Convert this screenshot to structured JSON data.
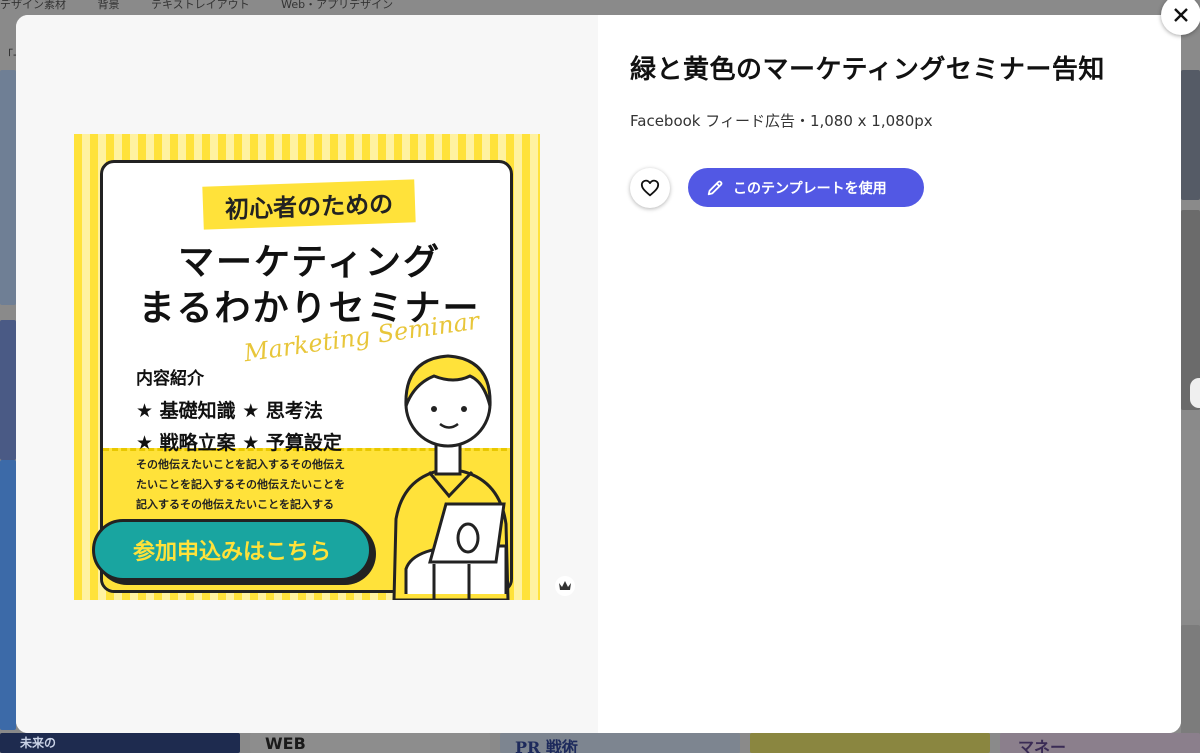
{
  "background": {
    "nav_items": [
      "デザイン素材",
      "背景",
      "テキストレイアウト",
      "Web・アプリデザイン"
    ],
    "crumb": "「-",
    "bottom_texts": [
      "未来の",
      "WEB",
      "PR 戦術",
      "マネー"
    ]
  },
  "modal": {
    "title": "緑と黄色のマーケティングセミナー告知",
    "meta": "Facebook フィード広告・1,080 x 1,080px",
    "use_button_label": "このテンプレートを使用",
    "icons": {
      "close": "close-icon",
      "favorite": "heart-icon",
      "use": "pencil-icon",
      "badge": "crown-icon"
    },
    "colors": {
      "accent": "#5258e4",
      "art_yellow": "#ffe23a",
      "art_teal": "#19a5a0"
    }
  },
  "template": {
    "subtitle": "初心者のための",
    "main_line1": "マーケティング",
    "main_line2": "まるわかりセミナー",
    "script": "Marketing Seminar",
    "content_heading": "内容紹介",
    "content_line1": "★ 基礎知識 ★ 思考法",
    "content_line2": "★ 戦略立案 ★ 予算設定",
    "small_line1": "その他伝えたいことを記入するその他伝え",
    "small_line2": "たいことを記入するその他伝えたいことを",
    "small_line3": "記入するその他伝えたいことを記入する",
    "cta": "参加申込みはこちら"
  }
}
